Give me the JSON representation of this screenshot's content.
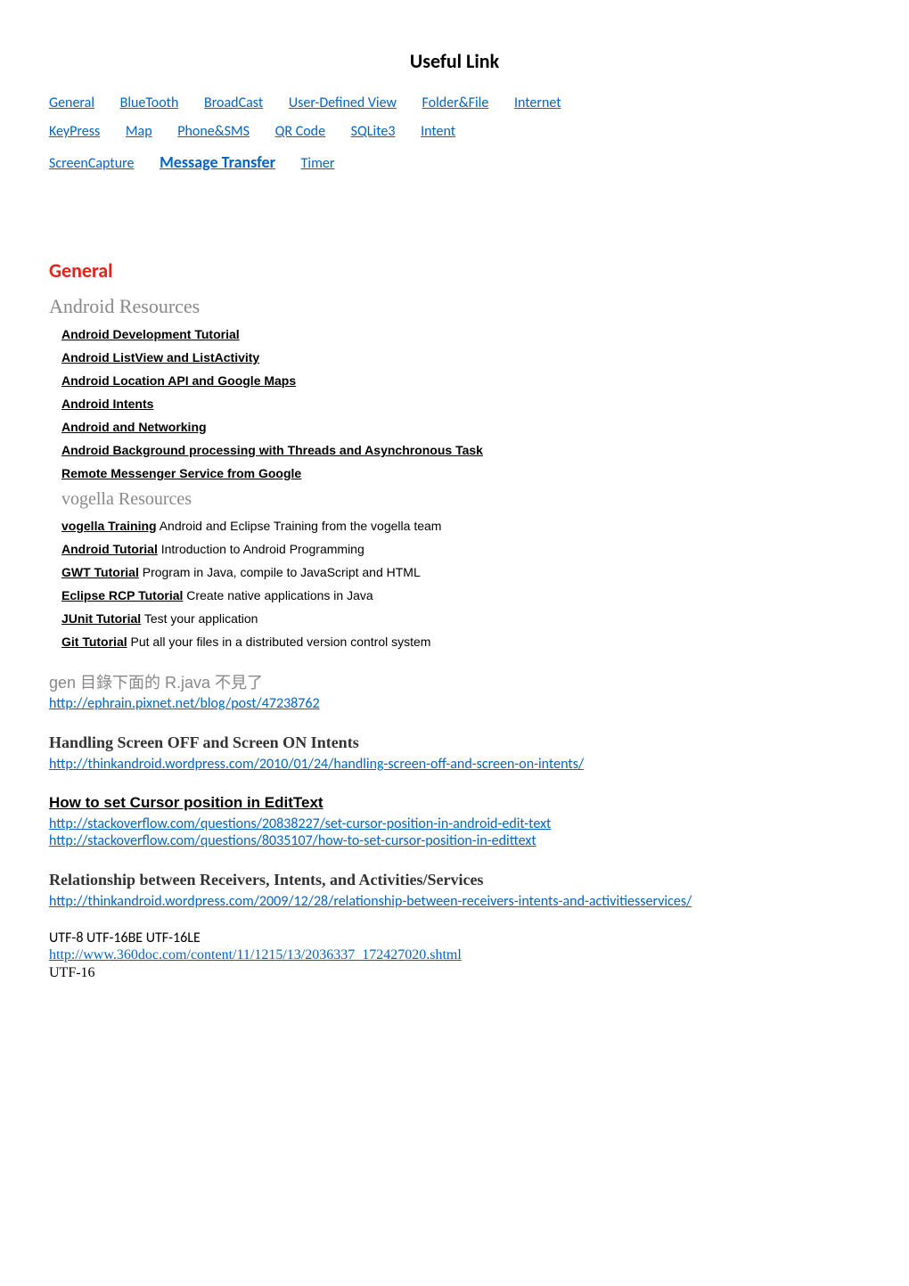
{
  "title": "Useful Link",
  "nav": {
    "general": "General",
    "bluetooth": "BlueTooth",
    "broadcast": "BroadCast",
    "userdefinedview": "User-Defined View",
    "folderfile": "Folder&File",
    "internet": "Internet",
    "keypress": "KeyPress",
    "map": "Map",
    "phonesms": "Phone&SMS",
    "qrcode": "QR Code",
    "sqlite3": "SQLite3",
    "intent": "Intent",
    "screencapture": "ScreenCapture",
    "messagetransfer": "Message Transfer",
    "timer": "Timer"
  },
  "section": {
    "general": "General"
  },
  "android_res_heading": "Android Resources",
  "android_res": {
    "r1": "Android Development Tutorial",
    "r2": "Android ListView and ListActivity",
    "r3": "Android Location API and Google Maps",
    "r4": "Android Intents",
    "r5": "Android and Networking",
    "r6": "Android Background processing with Threads and Asynchronous Task",
    "r7": "Remote Messenger Service from Google"
  },
  "vogella_heading": "vogella Resources",
  "vogella": {
    "r1_link": "vogella Training",
    "r1_desc": " Android and Eclipse Training from the vogella team",
    "r2_link": "Android Tutorial",
    "r2_desc": " Introduction to Android Programming",
    "r3_link": "GWT Tutorial",
    "r3_desc": " Program in Java, compile to JavaScript and HTML",
    "r4_link": "Eclipse RCP Tutorial",
    "r4_desc": " Create native applications in Java",
    "r5_link": "JUnit Tutorial",
    "r5_desc": " Test your application",
    "r6_link": "Git Tutorial",
    "r6_desc": " Put all your files in a distributed version control system"
  },
  "gen_heading": "gen 目錄下面的 R.java 不見了",
  "gen_link": "http://ephrain.pixnet.net/blog/post/47238762",
  "screen_heading": "Handling Screen OFF and Screen ON Intents",
  "screen_link": "http://thinkandroid.wordpress.com/2010/01/24/handling-screen-off-and-screen-on-intents/",
  "cursor_heading": "How to set Cursor position in EditText",
  "cursor_link1": "http://stackoverflow.com/questions/20838227/set-cursor-position-in-android-edit-text",
  "cursor_link2": "http://stackoverflow.com/questions/8035107/how-to-set-cursor-position-in-edittext",
  "rel_heading": "Relationship between Receivers, Intents, and Activities/Services",
  "rel_link": "http://thinkandroid.wordpress.com/2009/12/28/relationship-between-receivers-intents-and-activitiesservices/",
  "utf_text": "UTF-8  UTF-16BE  UTF-16LE",
  "utf_link": "http://www.360doc.com/content/11/1215/13/2036337_172427020.shtml",
  "utf16": "UTF-16"
}
